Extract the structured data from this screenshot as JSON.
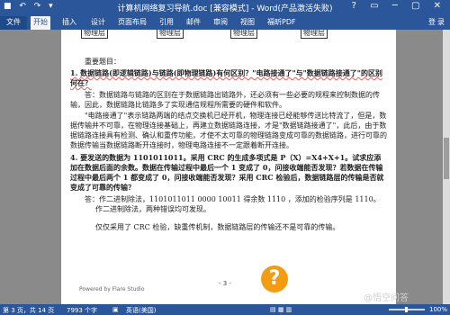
{
  "window": {
    "title": "计算机网络复习导航.doc [兼容模式] - Word(产品激活失败)",
    "qat": "■ ↶ ↷ ▾",
    "controls": "?  ▭  ─  ▢  ✕"
  },
  "ribbon": {
    "tabs": [
      "文件",
      "开始",
      "插入",
      "设计",
      "页面布局",
      "引用",
      "邮件",
      "审阅",
      "视图",
      "福昕PDF"
    ],
    "right": "登录"
  },
  "document": {
    "diagram_boxes": [
      "物理层",
      "物理层",
      "物理层",
      "物理层"
    ],
    "heading": "重要题目：",
    "q1": "1. 数据链路(即逻辑链路)与链路(即物理链路)有何区别？\"电路接通了\"与\"数据链路接通了\"的区别何在？",
    "a1": "答：数据链路与链路的区别在于数据链路出链路外，还必须有一些必要的规程来控制数据的传输，因此，数据链路比链路多了实现通信规程所需要的硬件和软件。",
    "a1b": "\"电路接通了\"表示链路两端的结点交换机已经开机，物理连接已经能够传送比特流了，但是，数据传输并不可靠，在物理连接基础上，再建立数据链路连接，才是\"数据链路接通了\"，此后，由于数据链路连接具有检测、确认和重传功能，才使不太可靠的物理链路变成可靠的数据链路，进行可靠的数据传输当数据链路断开连接时，物理电路连接不一定跟着断开连接。",
    "q4": "4. 要发送的数据为 1101011011。采用 CRC 的生成多项式是 P（X）=X4+X+1。试求应添加在数据后面的余数。数据在传输过程中最后一个 1 变成了 0，问接收端能否发现？若数据在传输过程中最后两个 1 都变成了 0，问接收端能否发现？采用 CRC 检验后，数据链路层的传输是否就变成了可靠的传输？",
    "a4": "答：作二进制除法，1101011011 0000          10011  得余数 1110 ，添加的检验序列是 1110。",
    "a4b": "作二进制除法，两种错误均可发现。",
    "a4c": "仅仅采用了 CRC 检验，缺重传机制，数据链路层的传输还不是可靠的传输。",
    "page_number": "- 3 -",
    "footer": "Powered by Flare Studio"
  },
  "overlay": {
    "question_glyph": "?",
    "watermark": "@悟空问答"
  },
  "status": {
    "page": "第 3 页，共 14 页",
    "words": "7993 个字",
    "lang": "英语(美国)",
    "zoom": "100%"
  },
  "colors": {
    "accent": "#2b579a",
    "orange": "#f39c12"
  }
}
